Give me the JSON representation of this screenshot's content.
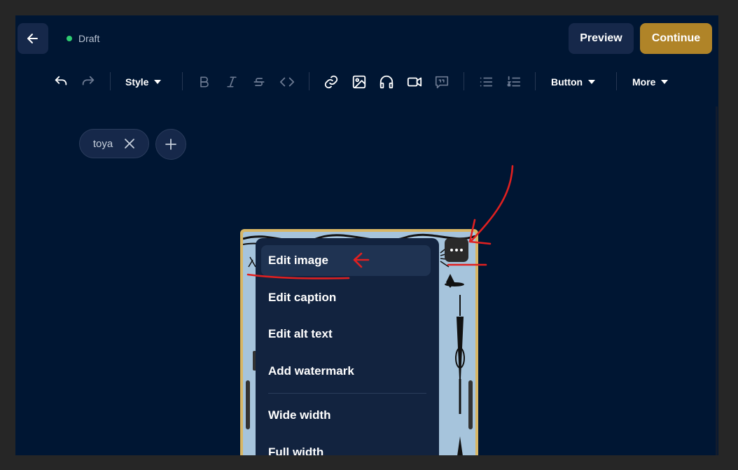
{
  "header": {
    "back_icon": "arrow-left-icon",
    "status": "Draft",
    "status_color": "#2ecc71",
    "preview_label": "Preview",
    "continue_label": "Continue",
    "continue_color": "#b08428"
  },
  "toolbar": {
    "style_label": "Style",
    "button_label": "Button",
    "more_label": "More",
    "icons": [
      "undo-icon",
      "redo-icon",
      "bold-icon",
      "italic-icon",
      "strikethrough-icon",
      "code-icon",
      "link-icon",
      "image-icon",
      "audio-icon",
      "video-icon",
      "quote-icon",
      "bullet-list-icon",
      "numbered-list-icon"
    ]
  },
  "tags": {
    "items": [
      {
        "label": "toya"
      }
    ]
  },
  "image_menu": {
    "items": [
      {
        "label": "Edit image"
      },
      {
        "label": "Edit caption"
      },
      {
        "label": "Edit alt text"
      },
      {
        "label": "Add watermark"
      },
      {
        "label": "Wide width"
      },
      {
        "label": "Full width"
      }
    ]
  },
  "colors": {
    "background": "#001633",
    "surface": "#16284a",
    "annotation": "#e02020"
  }
}
